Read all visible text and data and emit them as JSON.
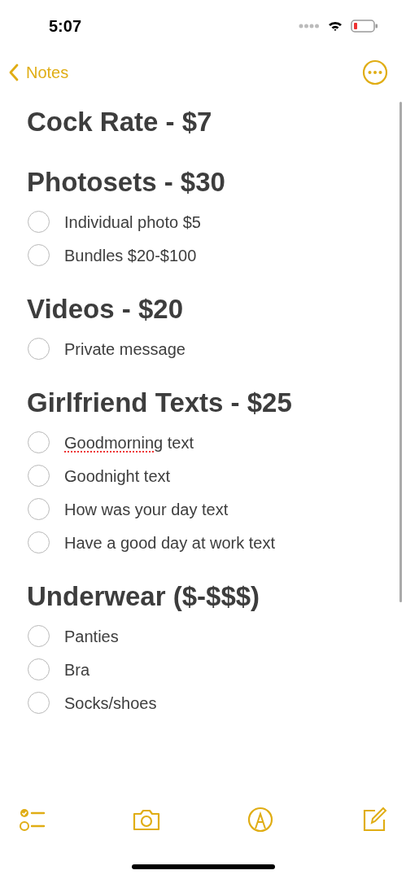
{
  "status_bar": {
    "time": "5:07"
  },
  "nav": {
    "back_label": "Notes"
  },
  "sections": [
    {
      "heading": "Cock Rate - $7"
    },
    {
      "heading": "Photosets - $30",
      "items": [
        {
          "label": "Individual photo $5",
          "checked": false
        },
        {
          "label": "Bundles $20-$100",
          "checked": false
        }
      ]
    },
    {
      "heading": "Videos - $20",
      "items": [
        {
          "label": "Private message",
          "checked": false
        }
      ]
    },
    {
      "heading": "Girlfriend Texts - $25",
      "items": [
        {
          "flagged": "Goodmorning",
          "label": "text",
          "checked": false
        },
        {
          "label": "Goodnight text",
          "checked": false
        },
        {
          "label": "How was your day text",
          "checked": false
        },
        {
          "label": "Have a good day at work text",
          "checked": false
        }
      ]
    },
    {
      "heading": "Underwear ($-$$$)",
      "items": [
        {
          "label": "Panties",
          "checked": false
        },
        {
          "label": "Bra",
          "checked": false
        },
        {
          "label": "Socks/shoes",
          "checked": false
        }
      ]
    }
  ]
}
